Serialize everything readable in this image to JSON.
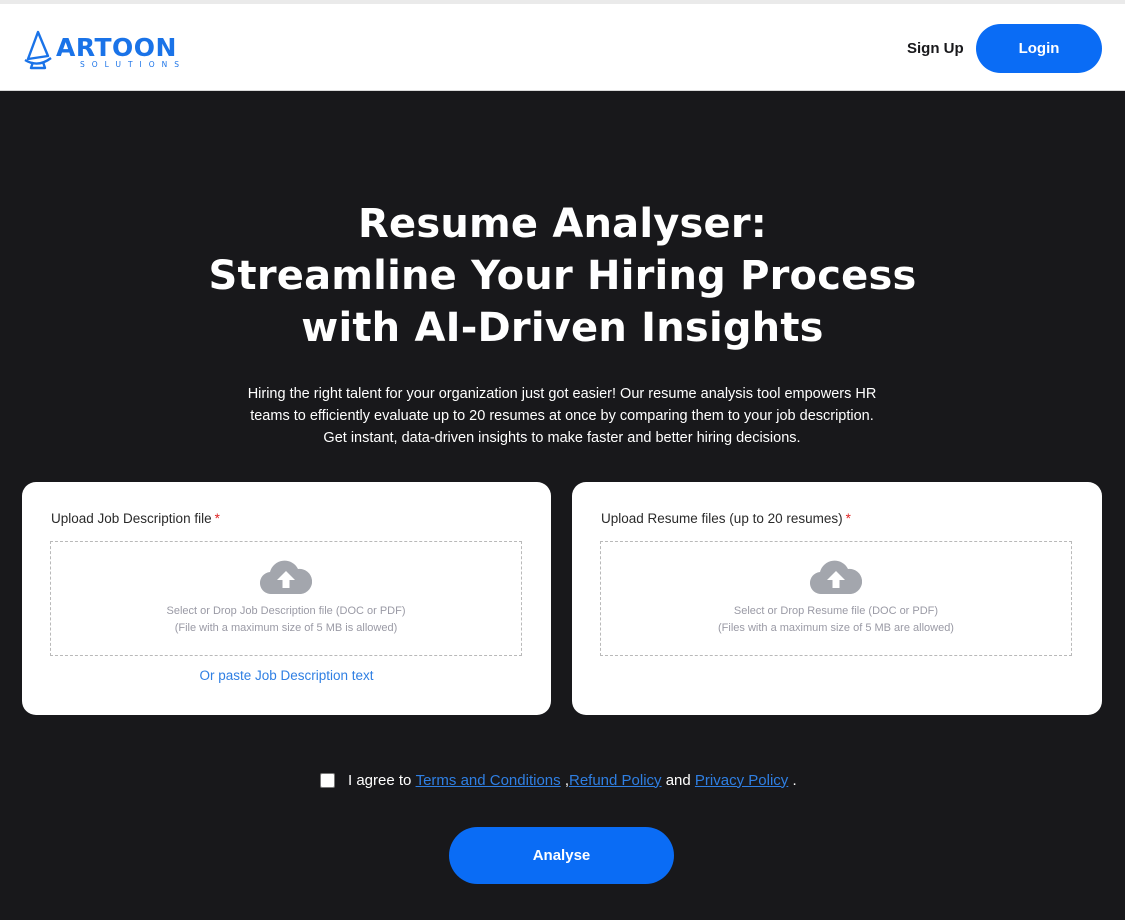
{
  "brand": {
    "logo_word": "ARTOON",
    "logo_sub": "SOLUTIONS",
    "accent_color": "#0a6cf5"
  },
  "header": {
    "signup_label": "Sign Up",
    "login_label": "Login"
  },
  "hero": {
    "title_lines": [
      "Resume Analyser:",
      "Streamline Your Hiring Process",
      "with AI-Driven Insights"
    ],
    "description_lines": [
      "Hiring the right talent for your organization just got easier! Our resume analysis tool empowers HR",
      "teams to efficiently evaluate up to 20 resumes at once by comparing them to your job description.",
      "Get instant, data-driven insights to make faster and better hiring decisions."
    ]
  },
  "job_upload": {
    "label": "Upload Job Description file",
    "required_mark": "*",
    "icon": "cloud-upload-icon",
    "hint_line1": "Select or Drop Job Description file (DOC or PDF)",
    "hint_line2": "(File with a maximum size of 5 MB is allowed)",
    "paste_link": "Or paste Job Description text"
  },
  "resume_upload": {
    "label": "Upload Resume files (up to 20 resumes)",
    "required_mark": "*",
    "icon": "cloud-upload-icon",
    "hint_line1": "Select or Drop Resume file (DOC or PDF)",
    "hint_line2": "(Files with a maximum size of 5 MB are allowed)"
  },
  "agreement": {
    "prefix": "I agree to",
    "terms": "Terms and Conditions",
    "sep1": ",",
    "refund": "Refund Policy",
    "and": "and",
    "privacy": "Privacy Policy",
    "suffix": ".",
    "checked": false
  },
  "analyse_label": "Analyse"
}
